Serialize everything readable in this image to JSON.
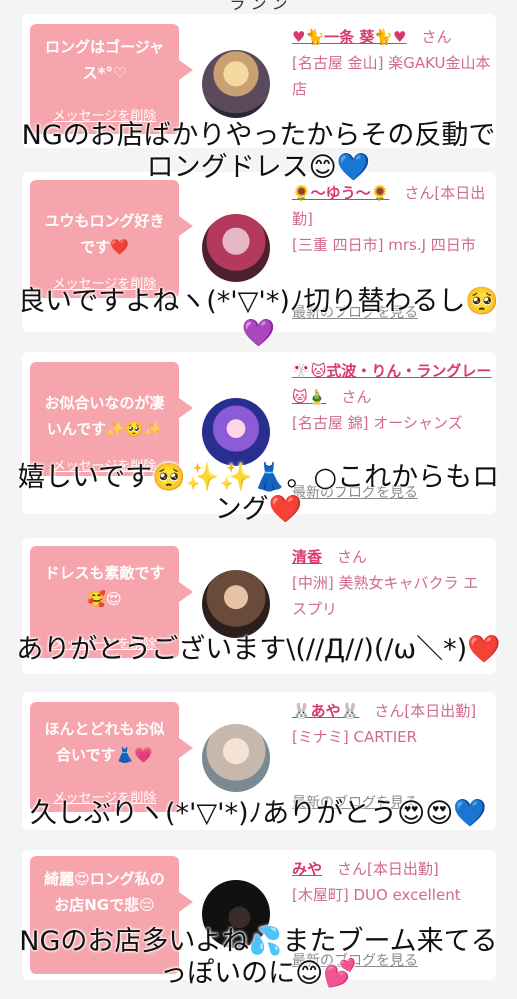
{
  "top_fragment": "ラ ン ン",
  "common": {
    "delete_label": "メッセージを削除",
    "san": "さん",
    "latest_blog": "最新のブログを見る"
  },
  "cards": [
    {
      "message": "ロングはゴージャス*°♡",
      "name": "♥🐈一条 葵🐈♥",
      "suffix": "さん",
      "shop": "[名古屋 金山] 楽GAKU金山本店",
      "blog": "最新のブログを見る"
    },
    {
      "message": "ユウもロング好きです❤️",
      "name": "🌻〜ゆう〜🌻",
      "suffix": "さん[本日出勤]",
      "shop": "[三重 四日市] mrs.J 四日市",
      "blog": "最新のブログを見る"
    },
    {
      "message": "お似合いなのが凄いんです✨🥺✨",
      "name": "🎌🐱式波・りん・ラングレー🐱🎍",
      "suffix": "さん",
      "shop": "[名古屋 錦] オーシャンズ",
      "blog": "最新のブログを見る"
    },
    {
      "message": "ドレスも素敵です🥰😍",
      "name": "清香",
      "suffix": "さん",
      "shop": "[中洲] 美熟女キャバクラ エスプリ",
      "blog": ""
    },
    {
      "message": "ほんとどれもお似合いです👗💗",
      "name": "🐰あや🐰",
      "suffix": "さん[本日出勤]",
      "shop": "[ミナミ] CARTIER",
      "blog": "最新のブログを見る"
    },
    {
      "message": "綺麗😍ロング私のお店NGで悲😔",
      "name": "みや",
      "suffix": "さん[本日出勤]",
      "shop": "[木屋町] DUO excellent",
      "blog": "最新のブログを見る"
    }
  ],
  "overlays": [
    "NGのお店ばかりやったからその反動でロングドレス😊💙",
    "良いですよねヽ(*'▽'*)ﾉ切り替わるし🥺💜",
    "嬉しいです🥺✨✨👗。○これからもロング❤️",
    "ありがとうございます\\(//Д//)(/ω＼*)❤️",
    "久しぶりヽ(*'▽'*)ﾉありがとう😍😍💙",
    "NGのお店多いよね💦またブーム来てるっぽいのに😊💕"
  ]
}
